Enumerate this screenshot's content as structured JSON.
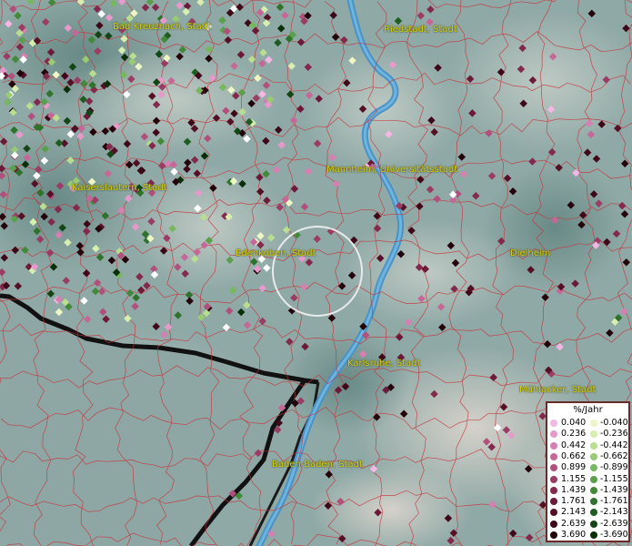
{
  "map": {
    "cities": [
      {
        "id": "bad-kreuznach",
        "label": "Bad Kreuznach, Stadt"
      },
      {
        "id": "riedstadt",
        "label": "Riedstadt, Stadt"
      },
      {
        "id": "kaiserslautern",
        "label": "Kaiserslautern, Stadt"
      },
      {
        "id": "mannheim",
        "label": "Mannheim, Universitätsstadt"
      },
      {
        "id": "edenkoben",
        "label": "Edenkoben, Stadt"
      },
      {
        "id": "dielheim",
        "label": "Dielheim"
      },
      {
        "id": "karlsruhe",
        "label": "Karlsruhe, Stadt"
      },
      {
        "id": "muehlacker",
        "label": "Mühlacker, Stadt"
      },
      {
        "id": "baden-baden",
        "label": "Baden-Baden, Stadt"
      }
    ]
  },
  "legend": {
    "title": "%/Jahr",
    "positive": [
      "0.040",
      "0.236",
      "0.442",
      "0.662",
      "0.899",
      "1.155",
      "1.439",
      "1.761",
      "2.143",
      "2.639",
      "3.690"
    ],
    "negative": [
      "-0.040",
      "-0.236",
      "-0.442",
      "-0.662",
      "-0.899",
      "-1.155",
      "-1.439",
      "-1.761",
      "-2.143",
      "-2.639",
      "-3.690"
    ],
    "positive_colors": [
      "#f4b6e2",
      "#e69acb",
      "#d680b2",
      "#c56897",
      "#b1507d",
      "#9a3c63",
      "#83294b",
      "#6c1a37",
      "#561026",
      "#3f0818",
      "#24030b"
    ],
    "negative_colors": [
      "#eef7c4",
      "#d7efae",
      "#b9de8f",
      "#98cb74",
      "#77b75e",
      "#5aa04a",
      "#428939",
      "#2f722b",
      "#1f5c1f",
      "#134614",
      "#092f09"
    ]
  }
}
